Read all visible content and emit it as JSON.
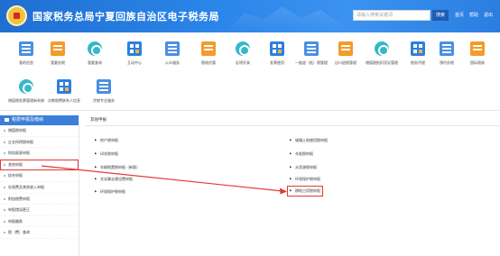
{
  "header": {
    "title": "国家税务总局宁夏回族自治区电子税务局",
    "search_placeholder": "请输入搜索关键词",
    "search_button": "搜索",
    "links": [
      "首页",
      "帮助",
      "退出"
    ]
  },
  "top_icons": [
    {
      "label": "我的信息",
      "icon": "doc"
    },
    {
      "label": "我要办税",
      "icon": "orange"
    },
    {
      "label": "我要查询",
      "icon": "teal"
    },
    {
      "label": "互动中心",
      "icon": "blue2"
    },
    {
      "label": "公众服务",
      "icon": "doc"
    },
    {
      "label": "税收优惠",
      "icon": "orange"
    },
    {
      "label": "证明开具",
      "icon": "teal"
    },
    {
      "label": "发票使用",
      "icon": "blue2"
    },
    {
      "label": "一般退（抵）税管理",
      "icon": "doc"
    },
    {
      "label": "出口退税管理",
      "icon": "orange"
    },
    {
      "label": "增值税抵扣凭证管理",
      "icon": "teal"
    },
    {
      "label": "税务代理",
      "icon": "blue2"
    },
    {
      "label": "预约办税",
      "icon": "doc"
    },
    {
      "label": "国际税收",
      "icon": "orange"
    },
    {
      "label": "增值税发票管理新系统",
      "icon": "teal"
    },
    {
      "label": "次数税费联系人信息",
      "icon": "blue2"
    },
    {
      "label": "涉税专业服务",
      "icon": "doc"
    }
  ],
  "sidebar": {
    "title": "税费申报及缴纳",
    "items": [
      "增值税申报",
      "企业所得税申报",
      "财务报表申报",
      "其他申报",
      "综合申报",
      "社保费及其他收入申报",
      "附加税费申报",
      "申报错误更正",
      "申报缴款",
      "税（费）查询"
    ],
    "active_index": 3
  },
  "main": {
    "section_title": "其他申报",
    "left_links": [
      "房产税申报",
      "印花税申报",
      "车辆购置税申报（新版）",
      "文化事业建设费申报",
      "环境保护税申报"
    ],
    "right_links": [
      "城镇土地使用税申报",
      "车船税申报",
      "水资源税申报",
      "环境保护税申报",
      "耕地占用税申报"
    ],
    "highlighted_link": "耕地占用税申报"
  },
  "colors": {
    "header_blue": "#2c86ea",
    "highlight_red": "#e53935",
    "sidebar_head": "#3b7fd8"
  }
}
